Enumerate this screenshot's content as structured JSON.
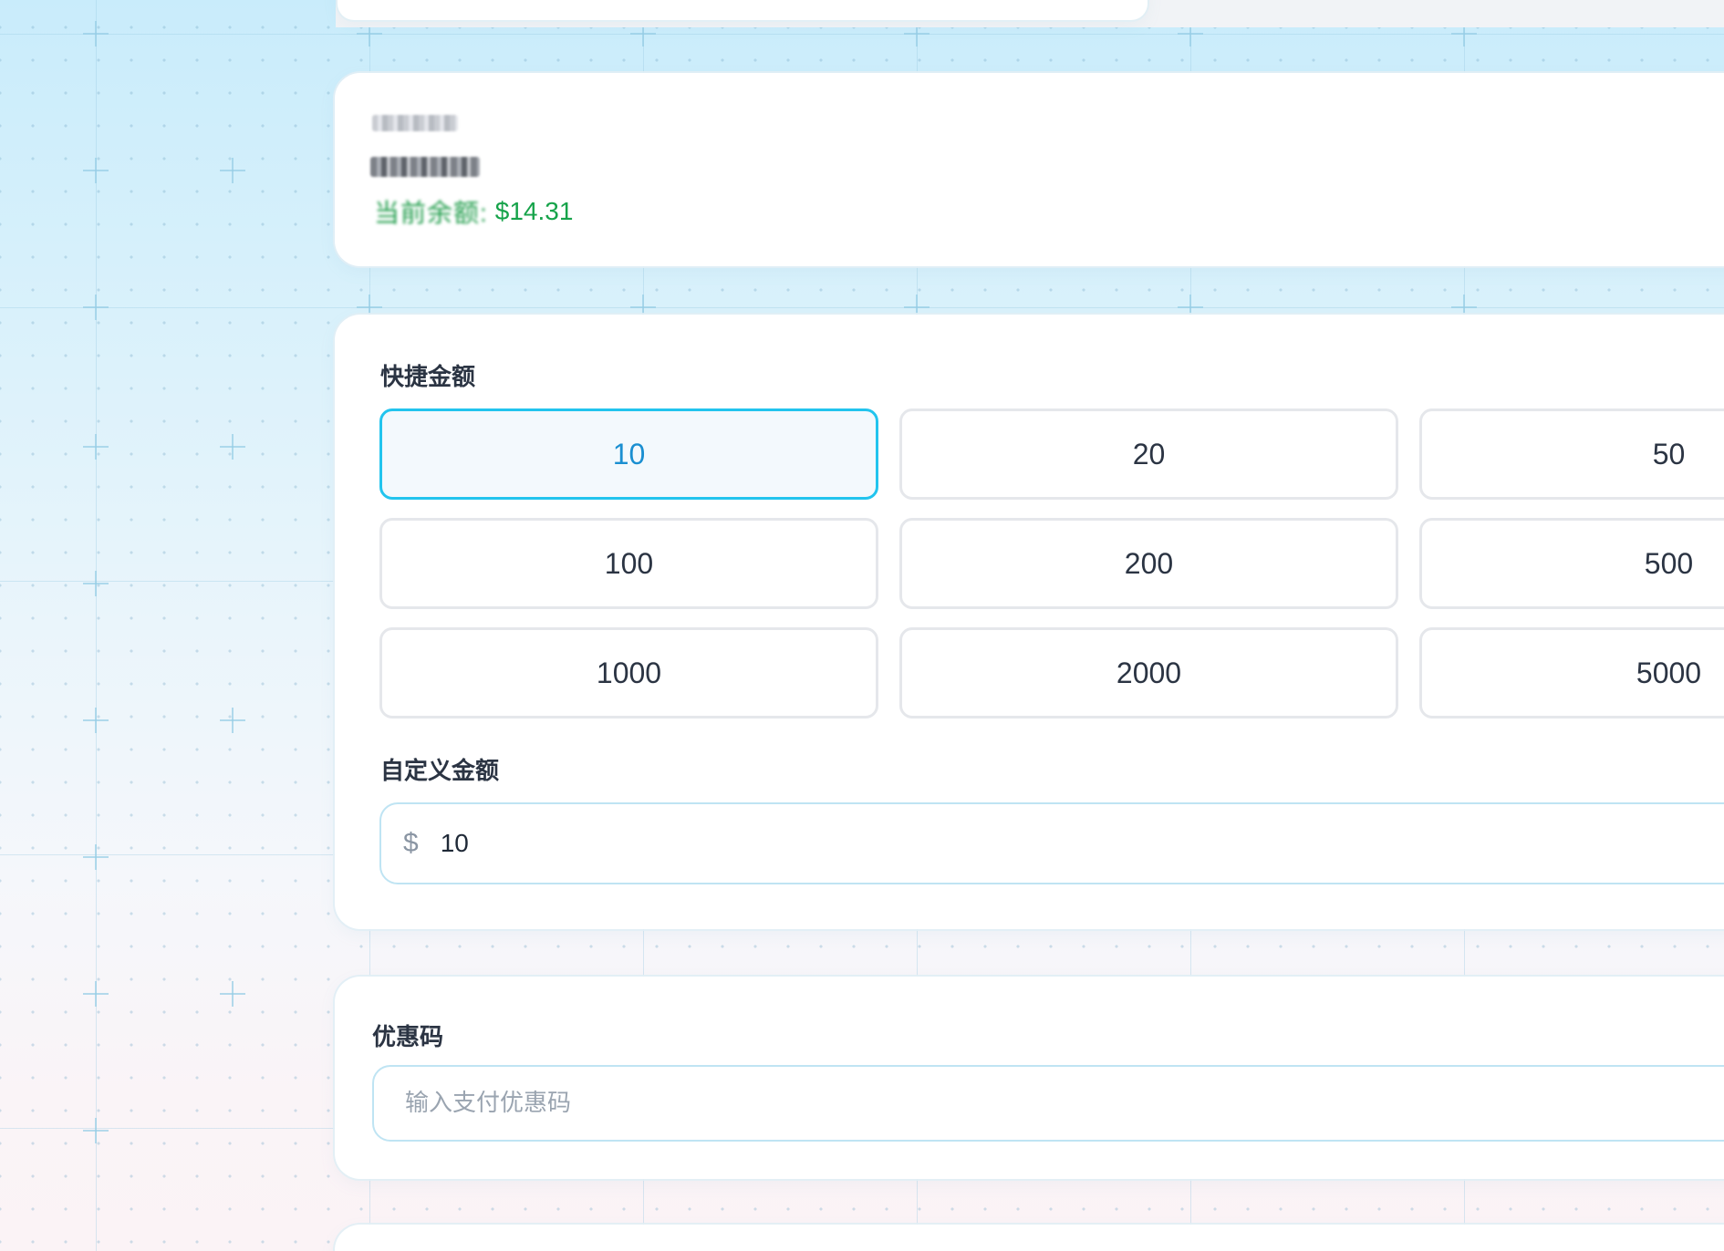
{
  "account": {
    "current_balance_label": "当前余额:",
    "current_balance_value": "$14.31"
  },
  "quick_amount": {
    "label": "快捷金额",
    "options": [
      "10",
      "20",
      "50",
      "100",
      "200",
      "500",
      "1000",
      "2000",
      "5000"
    ],
    "selected": "10"
  },
  "custom_amount": {
    "label": "自定义金额",
    "currency_symbol": "$",
    "value": "10"
  },
  "coupon": {
    "label": "优惠码",
    "placeholder": "输入支付优惠码"
  },
  "colors": {
    "accent": "#22c4ee",
    "selected_text": "#1a8fd1",
    "balance_green": "#16a34a"
  }
}
